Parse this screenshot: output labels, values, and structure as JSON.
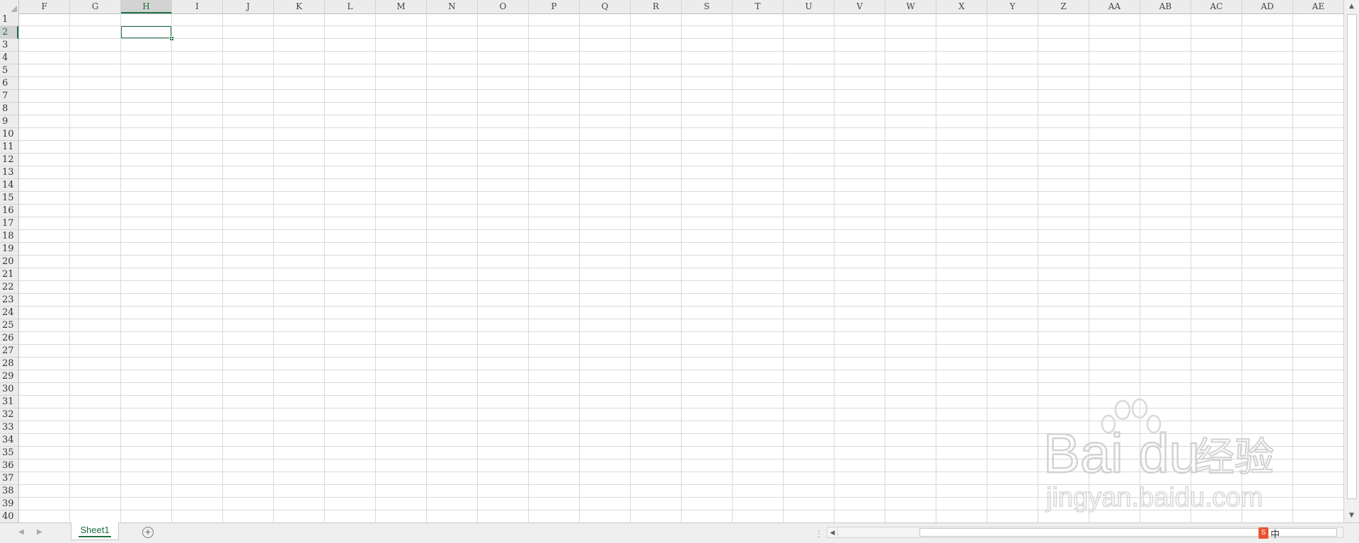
{
  "spreadsheet": {
    "columns": [
      "F",
      "G",
      "H",
      "I",
      "J",
      "K",
      "L",
      "M",
      "N",
      "O",
      "P",
      "Q",
      "R",
      "S",
      "T",
      "U",
      "V",
      "W",
      "X",
      "Y",
      "Z",
      "AA",
      "AB",
      "AC",
      "AD",
      "AE"
    ],
    "rows": [
      "1",
      "2",
      "3",
      "4",
      "5",
      "6",
      "7",
      "8",
      "9",
      "10",
      "11",
      "12",
      "13",
      "14",
      "15",
      "16",
      "17",
      "18",
      "19",
      "20",
      "21",
      "22",
      "23",
      "24",
      "25",
      "26",
      "27",
      "28",
      "29",
      "30",
      "31",
      "32",
      "33",
      "34",
      "35",
      "36",
      "37",
      "38",
      "39",
      "40"
    ],
    "active_column": "H",
    "active_row": "2"
  },
  "tabs": {
    "sheet_name": "Sheet1",
    "add_sheet_symbol": "+"
  },
  "tray": {
    "ime_label": "S",
    "language": "中"
  },
  "watermark": {
    "brand": "Bai du",
    "cn_text": "经验",
    "url": "jingyan.baidu.com"
  },
  "colors": {
    "accent": "#217346",
    "header_bg": "#ececec",
    "grid_line": "#d9d9d9"
  }
}
